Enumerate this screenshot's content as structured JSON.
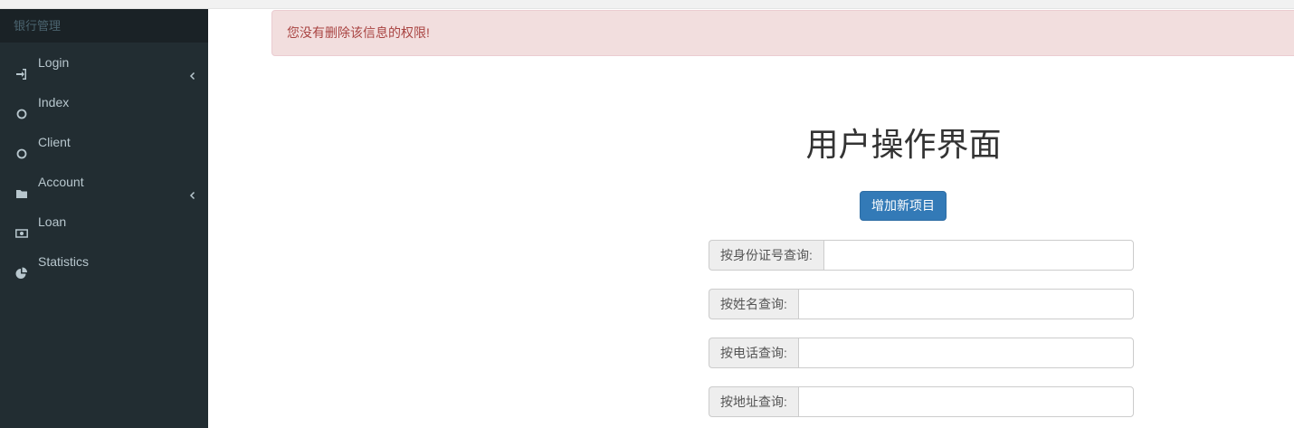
{
  "sidebar": {
    "header": "银行管理",
    "items": [
      {
        "label": "Login",
        "icon": "sign-in-icon",
        "expandable": true
      },
      {
        "label": "Index",
        "icon": "circle-icon",
        "expandable": false
      },
      {
        "label": "Client",
        "icon": "circle-icon",
        "expandable": false
      },
      {
        "label": "Account",
        "icon": "folder-icon",
        "expandable": true
      },
      {
        "label": "Loan",
        "icon": "money-icon",
        "expandable": false
      },
      {
        "label": "Statistics",
        "icon": "pie-chart-icon",
        "expandable": false
      }
    ]
  },
  "alert": {
    "message": "您没有删除该信息的权限!"
  },
  "main": {
    "title": "用户操作界面",
    "add_button": "增加新项目",
    "searches": [
      {
        "label": "按身份证号查询:",
        "value": ""
      },
      {
        "label": "按姓名查询:",
        "value": ""
      },
      {
        "label": "按电话查询:",
        "value": ""
      },
      {
        "label": "按地址查询:",
        "value": ""
      }
    ]
  },
  "colors": {
    "sidebar_bg": "#222d32",
    "sidebar_text": "#b8c7ce",
    "alert_bg": "#f2dede",
    "alert_text": "#a94442",
    "primary": "#337ab7"
  }
}
